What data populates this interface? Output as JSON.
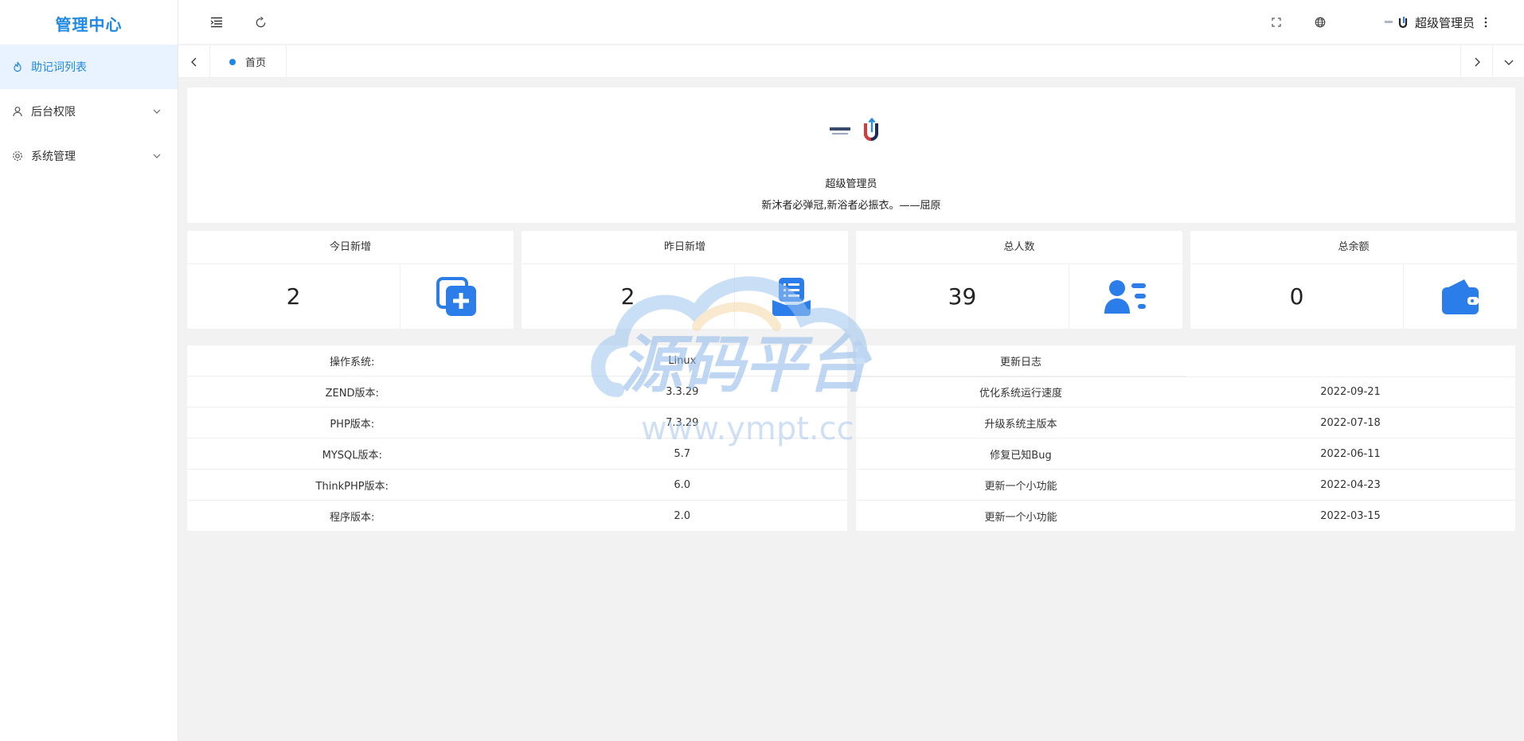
{
  "sidebar": {
    "title": "管理中心",
    "items": [
      {
        "label": "助记词列表",
        "icon": "fire-icon",
        "active": true
      },
      {
        "label": "后台权限",
        "icon": "user-icon",
        "expandable": true
      },
      {
        "label": "系统管理",
        "icon": "gear-icon",
        "expandable": true
      }
    ]
  },
  "header": {
    "user_name": "超级管理员",
    "icons": [
      "menu-fold-icon",
      "refresh-icon",
      "fullscreen-icon",
      "globe-icon",
      "more-icon"
    ]
  },
  "tabs": [
    {
      "label": "首页",
      "active": true
    }
  ],
  "profile": {
    "name": "超级管理员",
    "motto": "新沐者必弹冠,新浴者必振衣。——屈原"
  },
  "stats": [
    {
      "title": "今日新增",
      "value": "2",
      "icon": "add-copy-icon"
    },
    {
      "title": "昨日新增",
      "value": "2",
      "icon": "list-tray-icon"
    },
    {
      "title": "总人数",
      "value": "39",
      "icon": "user-list-icon"
    },
    {
      "title": "总余额",
      "value": "0",
      "icon": "wallet-icon"
    }
  ],
  "system_info": [
    {
      "label": "操作系统:",
      "value": "Linux"
    },
    {
      "label": "ZEND版本:",
      "value": "3.3.29"
    },
    {
      "label": "PHP版本:",
      "value": "7.3.29"
    },
    {
      "label": "MYSQL版本:",
      "value": "5.7"
    },
    {
      "label": "ThinkPHP版本:",
      "value": "6.0"
    },
    {
      "label": "程序版本:",
      "value": "2.0"
    }
  ],
  "changelog": {
    "header": "更新日志",
    "rows": [
      {
        "text": "优化系统运行速度",
        "date": "2022-09-21"
      },
      {
        "text": "升级系统主版本",
        "date": "2022-07-18"
      },
      {
        "text": "修复已知Bug",
        "date": "2022-06-11"
      },
      {
        "text": "更新一个小功能",
        "date": "2022-04-23"
      },
      {
        "text": "更新一个小功能",
        "date": "2022-03-15"
      }
    ]
  },
  "watermark": {
    "text": "源码平台",
    "url": "www.ympt.cc"
  },
  "colors": {
    "accent": "#1e88e5",
    "active_bg": "#e8f3ff",
    "icon_blue": "#2b7de9"
  }
}
